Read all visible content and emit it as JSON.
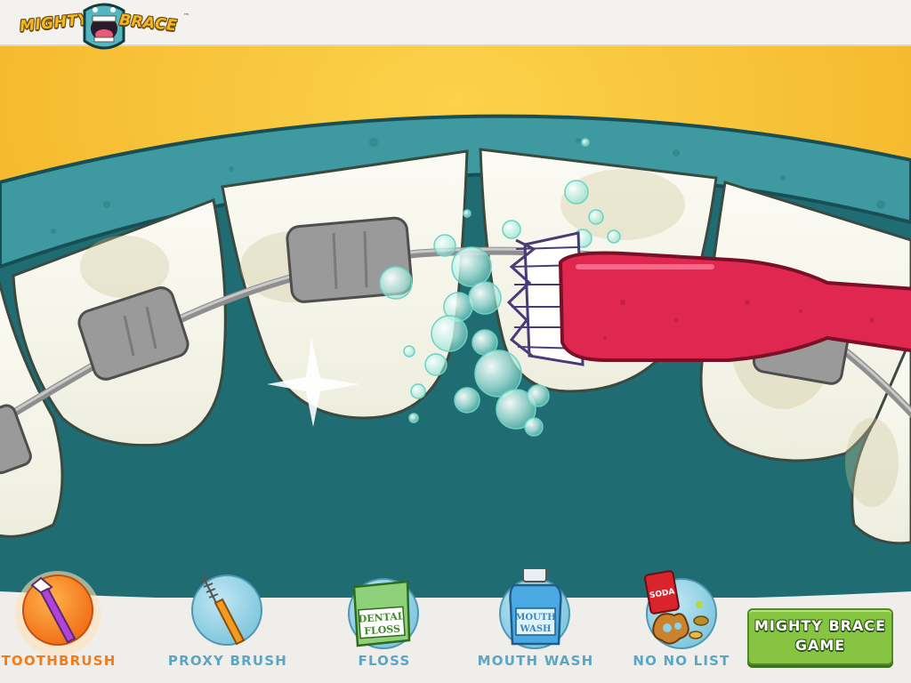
{
  "app": {
    "logo_left": "MIGHTY",
    "logo_right": "BRACE",
    "logo_tm": "™"
  },
  "scene": {
    "active_tool": "toothbrush",
    "icons": [
      "toothbrush-icon",
      "braces-bracket-icon",
      "foam-bubble-icon",
      "sparkle-icon"
    ]
  },
  "toolbar": {
    "tools": [
      {
        "id": "toothbrush",
        "label": "TOOTHBRUSH",
        "icon": "toothbrush-icon",
        "active": true
      },
      {
        "id": "proxy-brush",
        "label": "PROXY BRUSH",
        "icon": "proxy-brush-icon",
        "active": false
      },
      {
        "id": "floss",
        "label": "FLOSS",
        "icon": "floss-box-icon",
        "active": false,
        "icon_text": [
          "DENTAL",
          "FLOSS"
        ]
      },
      {
        "id": "mouth-wash",
        "label": "MOUTH WASH",
        "icon": "mouthwash-bottle-icon",
        "active": false,
        "icon_text": [
          "MOUTH",
          "WASH"
        ]
      },
      {
        "id": "no-no-list",
        "label": "NO NO LIST",
        "icon": "junk-food-icon",
        "active": false,
        "icon_text": [
          "SODA"
        ]
      }
    ],
    "game_button": {
      "line1": "MIGHTY BRACE",
      "line2": "GAME"
    }
  },
  "colors": {
    "active_label": "#f07c1e",
    "inactive_label": "#5aa6c4",
    "gum": "#2f8c92",
    "mouth": "#1d6a70",
    "brush": "#e0274f",
    "game_button": "#86c441"
  }
}
